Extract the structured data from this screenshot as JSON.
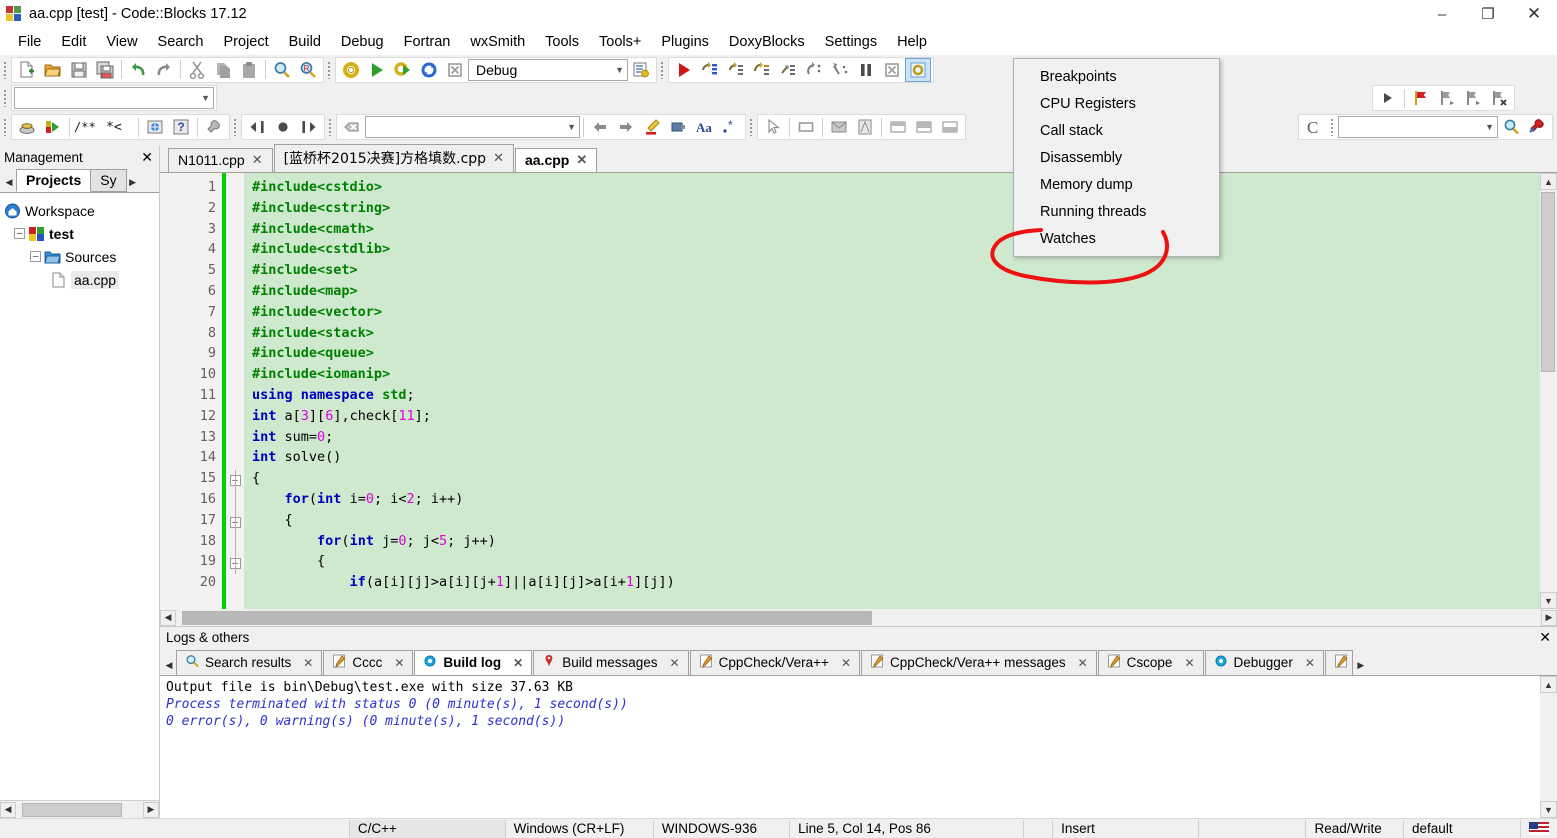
{
  "window": {
    "title": "aa.cpp [test] - Code::Blocks 17.12",
    "logo_name": "codeblocks-logo",
    "minimize": "–",
    "maximize": "❐",
    "close": "✕"
  },
  "menubar": {
    "items": [
      "File",
      "Edit",
      "View",
      "Search",
      "Project",
      "Build",
      "Debug",
      "Fortran",
      "wxSmith",
      "Tools",
      "Tools+",
      "Plugins",
      "DoxyBlocks",
      "Settings",
      "Help"
    ]
  },
  "toolbar": {
    "build_target": {
      "value": "Debug",
      "placeholder": ""
    },
    "symbol_combo": {
      "value": "",
      "placeholder": ""
    },
    "goto_combo": {
      "value": "",
      "placeholder": ""
    },
    "search_combo": {
      "value": "",
      "placeholder": ""
    },
    "main_icons": [
      "new-file-icon",
      "open-file-icon",
      "save-icon",
      "save-all-icon",
      "undo-icon",
      "redo-icon",
      "cut-icon",
      "copy-icon",
      "paste-icon",
      "find-icon",
      "replace-icon"
    ],
    "build_icons": [
      "build-icon",
      "run-icon",
      "build-and-run-icon",
      "rebuild-icon",
      "abort-icon"
    ],
    "debug_icons": [
      "debug-continue-icon",
      "next-line-icon",
      "step-into-icon",
      "next-instruction-icon",
      "step-into-instruction-icon",
      "step-out-icon",
      "step-by-step-icon",
      "break-icon",
      "stop-debugger-icon",
      "debugging-windows-icon"
    ],
    "bookmark_icons": [
      "toggle-bookmark-icon",
      "prev-bookmark-icon",
      "next-bookmark-icon",
      "clear-bookmarks-icon"
    ],
    "row3_icons": [
      "compile-icon",
      "run-to-cursor-icon",
      "doxyblocks-comment-icon",
      "doxyblocks-extract-icon",
      "doxyblocks-run-icon",
      "doxyblocks-help-icon",
      "doxyblocks-config-icon",
      "back-icon",
      "home-icon",
      "forward-icon",
      "close-icon"
    ],
    "wxsmith_icons": [
      "prev-icon",
      "next-icon",
      "highlight-icon",
      "insert-icon",
      "font-icon",
      "regex-icon",
      "pointer-icon",
      "panel-icon",
      "dialog-icon",
      "frame-icon",
      "layout-left-icon",
      "layout-right-icon",
      "layout-bottom-icon"
    ],
    "cscope_label": "C",
    "cscope_icons": [
      "cscope-search-icon",
      "cscope-settings-icon"
    ]
  },
  "debug_menu": {
    "items": [
      "Breakpoints",
      "CPU Registers",
      "Call stack",
      "Disassembly",
      "Memory dump",
      "Running threads",
      "Watches"
    ],
    "annotation_color": "#ee1111"
  },
  "management": {
    "title": "Management",
    "close": "✕",
    "prev_arrow": "◀",
    "next_arrow": "▶",
    "tabs": [
      {
        "label": "Projects",
        "active": true
      },
      {
        "label": "Sy",
        "active": false
      }
    ],
    "tree": [
      {
        "label": "Workspace",
        "icon": "workspace-icon",
        "depth": 0,
        "expander": "",
        "bold": false
      },
      {
        "label": "test",
        "icon": "project-icon",
        "depth": 1,
        "expander": "–",
        "bold": true
      },
      {
        "label": "Sources",
        "icon": "folder-icon",
        "depth": 2,
        "expander": "–",
        "bold": false
      },
      {
        "label": "aa.cpp",
        "icon": "file-icon",
        "depth": 3,
        "expander": "",
        "bold": false
      }
    ]
  },
  "editor": {
    "tabs": [
      {
        "label": "N1011.cpp",
        "active": false,
        "close": "✕"
      },
      {
        "label": "[蓝桥杯2015决赛]方格填数.cpp",
        "active": false,
        "close": "✕"
      },
      {
        "label": "aa.cpp",
        "active": true,
        "close": "✕"
      }
    ],
    "background_color": "#cfe9cf",
    "line_numbers": [
      1,
      2,
      3,
      4,
      5,
      6,
      7,
      8,
      9,
      10,
      11,
      12,
      13,
      14,
      15,
      16,
      17,
      18,
      19,
      20
    ],
    "lines": [
      {
        "n": 1,
        "html": "<span class='pp'>#include&lt;cstdio&gt;</span>"
      },
      {
        "n": 2,
        "html": "<span class='pp'>#include&lt;cstring&gt;</span>"
      },
      {
        "n": 3,
        "html": "<span class='pp'>#include&lt;cmath&gt;</span>"
      },
      {
        "n": 4,
        "html": "<span class='pp'>#include&lt;cstdlib&gt;</span>"
      },
      {
        "n": 5,
        "html": "<span class='pp'>#include&lt;set&gt;</span>"
      },
      {
        "n": 6,
        "html": "<span class='pp'>#include&lt;map&gt;</span>"
      },
      {
        "n": 7,
        "html": "<span class='pp'>#include&lt;vector&gt;</span>"
      },
      {
        "n": 8,
        "html": "<span class='pp'>#include&lt;stack&gt;</span>"
      },
      {
        "n": 9,
        "html": "<span class='pp'>#include&lt;queue&gt;</span>"
      },
      {
        "n": 10,
        "html": "<span class='pp'>#include&lt;iomanip&gt;</span>"
      },
      {
        "n": 11,
        "html": "<span class='k'>using namespace</span> <span class='pp'>std</span>;"
      },
      {
        "n": 12,
        "html": "<span class='k'>int</span> a[<span class='num'>3</span>][<span class='num'>6</span>],check[<span class='num'>11</span>];"
      },
      {
        "n": 13,
        "html": "<span class='k'>int</span> sum=<span class='num'>0</span>;"
      },
      {
        "n": 14,
        "html": "<span class='k'>int</span> solve()"
      },
      {
        "n": 15,
        "html": "{"
      },
      {
        "n": 16,
        "html": "    <span class='k'>for</span>(<span class='k'>int</span> i=<span class='num'>0</span>; i&lt;<span class='num'>2</span>; i++)"
      },
      {
        "n": 17,
        "html": "    {"
      },
      {
        "n": 18,
        "html": "        <span class='k'>for</span>(<span class='k'>int</span> j=<span class='num'>0</span>; j&lt;<span class='num'>5</span>; j++)"
      },
      {
        "n": 19,
        "html": "        {"
      },
      {
        "n": 20,
        "html": "            <span class='k'>if</span>(a[i][j]&gt;a[i][j+<span class='num'>1</span>]||a[i][j]&gt;a[i+<span class='num'>1</span>][j])"
      }
    ],
    "fold_lines": [
      15,
      17,
      19
    ],
    "scroll_left_arrow": "◀",
    "scroll_right_arrow": "▶",
    "scroll_up_arrow": "▲",
    "scroll_down_arrow": "▼"
  },
  "logs": {
    "title": "Logs & others",
    "close": "✕",
    "prev_arrow": "◀",
    "next_arrow": "▶",
    "tabs": [
      {
        "label": "Search results",
        "icon": "search-icon",
        "active": false,
        "close": "✕"
      },
      {
        "label": "Cccc",
        "icon": "pencil-icon",
        "active": false,
        "close": "✕"
      },
      {
        "label": "Build log",
        "icon": "gear-blue-icon",
        "active": true,
        "close": "✕"
      },
      {
        "label": "Build messages",
        "icon": "pin-icon",
        "active": false,
        "close": "✕"
      },
      {
        "label": "CppCheck/Vera++",
        "icon": "pencil-icon",
        "active": false,
        "close": "✕"
      },
      {
        "label": "CppCheck/Vera++ messages",
        "icon": "pencil-icon",
        "active": false,
        "close": "✕"
      },
      {
        "label": "Cscope",
        "icon": "pencil-icon",
        "active": false,
        "close": "✕"
      },
      {
        "label": "Debugger",
        "icon": "gear-blue-icon",
        "active": false,
        "close": "✕"
      },
      {
        "label": "",
        "icon": "pencil-icon",
        "active": false,
        "close": ""
      }
    ],
    "output": [
      {
        "text": "Output file is bin\\Debug\\test.exe with size 37.63 KB",
        "style": "black"
      },
      {
        "text": "Process terminated with status 0 (0 minute(s), 1 second(s))",
        "style": "blue"
      },
      {
        "text": "0 error(s), 0 warning(s) (0 minute(s), 1 second(s))",
        "style": "blue"
      }
    ]
  },
  "statusbar": {
    "fields": [
      "",
      "C/C++",
      "Windows (CR+LF)",
      "WINDOWS-936",
      "Line 5, Col 14, Pos 86",
      "",
      "Insert",
      "",
      "Read/Write",
      "default"
    ],
    "flag_icon": "us-flag-icon"
  }
}
